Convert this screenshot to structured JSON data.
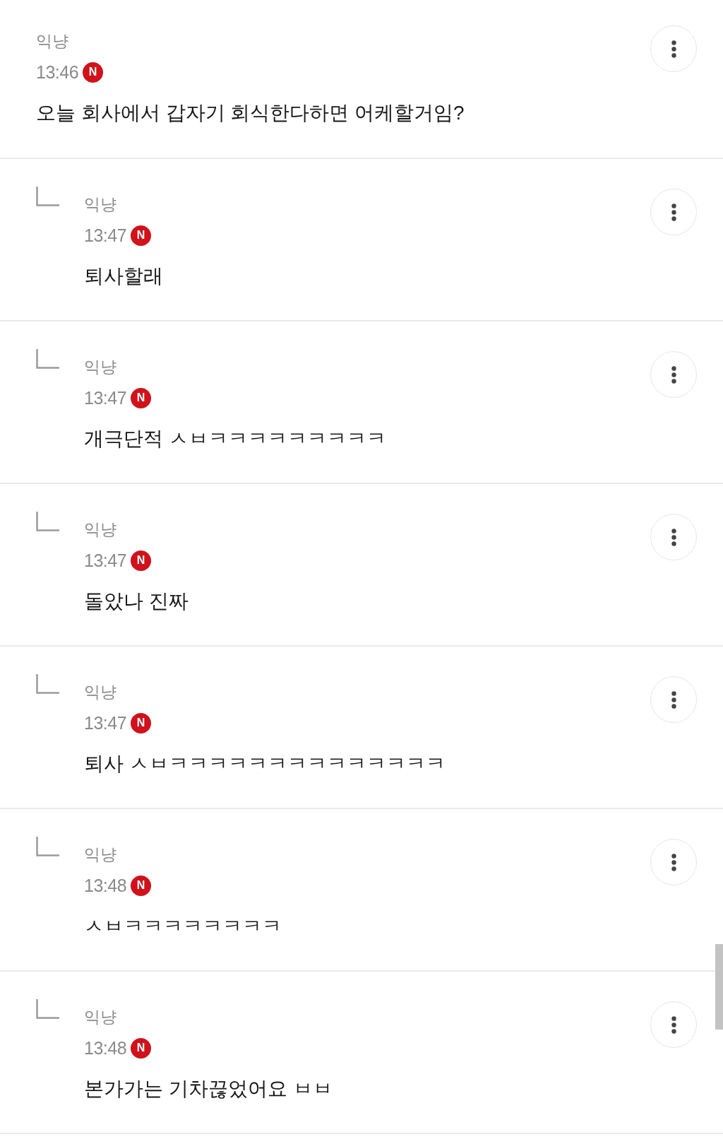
{
  "comments": [
    {
      "author": "익냥",
      "time": "13:46",
      "badge": "N",
      "text": "오늘 회사에서 갑자기 회식한다하면 어케할거임?",
      "children": [
        {
          "author": "익냥",
          "time": "13:47",
          "badge": "N",
          "text": "퇴사할래"
        },
        {
          "author": "익냥",
          "time": "13:47",
          "badge": "N",
          "text": "개극단적 ㅅㅂㅋㅋㅋㅋㅋㅋㅋㅋㅋ"
        },
        {
          "author": "익냥",
          "time": "13:47",
          "badge": "N",
          "text": "돌았나 진짜"
        },
        {
          "author": "익냥",
          "time": "13:47",
          "badge": "N",
          "text": "퇴사 ㅅㅂㅋㅋㅋㅋㅋㅋㅋㅋㅋㅋㅋㅋㅋㅋ"
        },
        {
          "author": "익냥",
          "time": "13:48",
          "badge": "N",
          "text": "ㅅㅂㅋㅋㅋㅋㅋㅋㅋㅋ"
        },
        {
          "author": "익냥",
          "time": "13:48",
          "badge": "N",
          "text": "본가가는 기차끊었어요 ㅂㅂ"
        }
      ]
    }
  ]
}
